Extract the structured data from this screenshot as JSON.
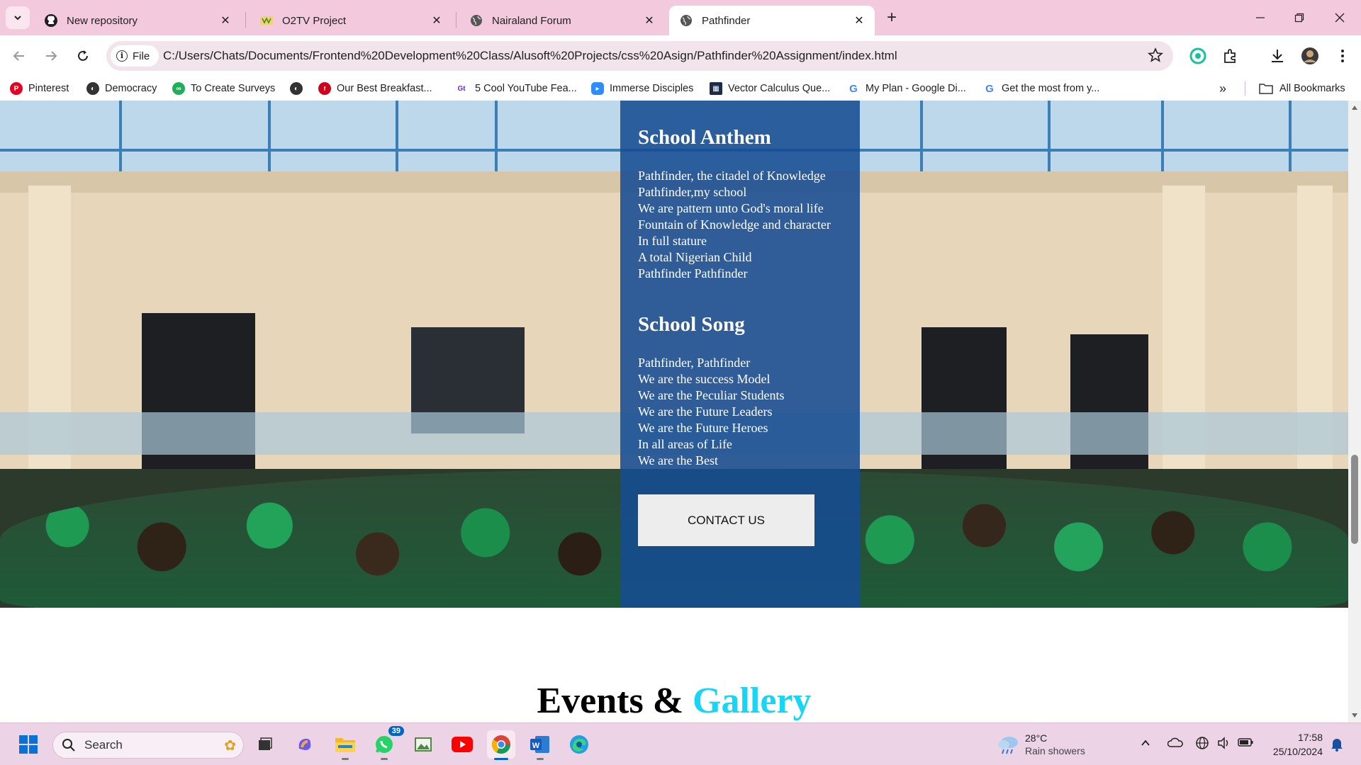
{
  "browser": {
    "tabs": [
      {
        "title": "New repository",
        "icon": "github-icon",
        "active": false
      },
      {
        "title": "O2TV Project",
        "icon": "o2tv-icon",
        "active": false
      },
      {
        "title": "Nairaland Forum",
        "icon": "globe-icon",
        "active": false
      },
      {
        "title": "Pathfinder",
        "icon": "globe-icon",
        "active": true
      }
    ],
    "site_chip": "File",
    "url": "C:/Users/Chats/Documents/Frontend%20Development%20Class/Alusoft%20Projects/css%20Asign/Pathfinder%20Assignment/index.html"
  },
  "bookmarks": {
    "items": [
      {
        "label": "Pinterest",
        "color": "#e60023"
      },
      {
        "label": "Democracy",
        "color": "#333333"
      },
      {
        "label": "To Create Surveys",
        "color": "#1fae5a"
      },
      {
        "label": "",
        "color": "#333333"
      },
      {
        "label": "Our Best Breakfast...",
        "color": "#d0021b"
      },
      {
        "label": "5 Cool YouTube Fea...",
        "color": "#6a2cc7"
      },
      {
        "label": "Immerse Disciples",
        "color": "#2d8cff"
      },
      {
        "label": "Vector Calculus Que...",
        "color": "#1a2b4c"
      },
      {
        "label": "My Plan - Google Di...",
        "color": "#4285f4"
      },
      {
        "label": "Get the most from y...",
        "color": "#4285f4"
      }
    ],
    "all_bookmarks": "All Bookmarks"
  },
  "page": {
    "anthem": {
      "heading": "School Anthem",
      "lines": [
        "Pathfinder, the citadel of Knowledge",
        "Pathfinder,my school",
        "We are pattern unto God's moral life",
        "Fountain of Knowledge and character",
        "In full stature",
        "A total Nigerian Child",
        "Pathfinder Pathfinder"
      ]
    },
    "song": {
      "heading": "School Song",
      "lines": [
        "Pathfinder, Pathfinder",
        "We are the success Model",
        "We are the Peculiar Students",
        "We are the Future Leaders",
        "We are the Future Heroes",
        "In all areas of Life",
        "We are the Best"
      ]
    },
    "contact_button": "CONTACT US",
    "events_title": {
      "part1": "Events & ",
      "part2": "Gallery",
      "accent_color": "#17d6f5"
    }
  },
  "taskbar": {
    "search_placeholder": "Search",
    "whatsapp_badge": "39",
    "weather": {
      "temp": "28°C",
      "desc": "Rain showers"
    },
    "time": "17:58",
    "date": "25/10/2024"
  }
}
